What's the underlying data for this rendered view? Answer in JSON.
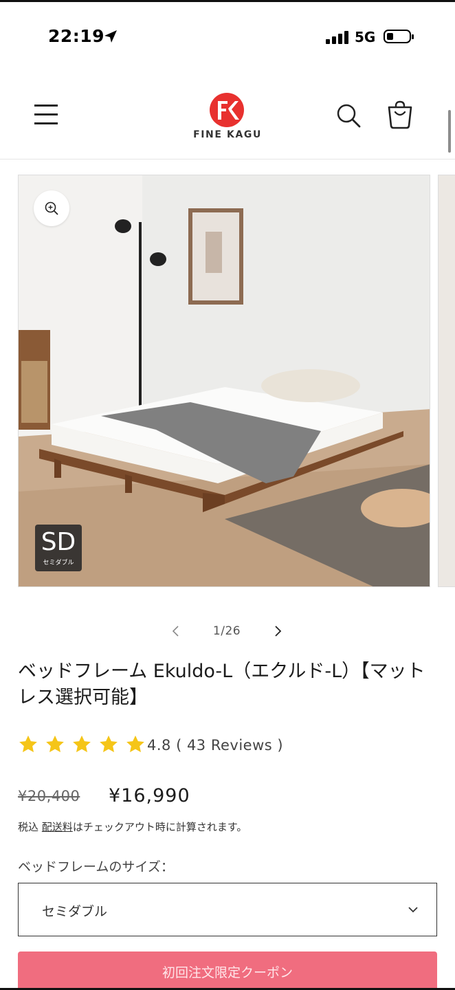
{
  "status_bar": {
    "time": "22:19",
    "network": "5G",
    "icons": [
      "location-arrow-icon",
      "signal-bars-icon",
      "battery-icon"
    ]
  },
  "header": {
    "brand": "FINE KAGU",
    "logo_mark": "FK",
    "icons": [
      "hamburger-menu-icon",
      "search-icon",
      "cart-icon",
      "fk-logo-icon"
    ],
    "colors": {
      "logo_red": "#e8312f"
    }
  },
  "gallery": {
    "size_badge_code": "SD",
    "size_badge_label": "セミダブル",
    "current": "1/26",
    "icons": [
      "zoom-in-icon",
      "chevron-left-icon",
      "chevron-right-icon"
    ]
  },
  "product": {
    "title": "ベッドフレーム Ekuldo-L（エクルド-L）【マットレス選択可能】",
    "rating": {
      "stars": 5,
      "text": "4.8 ( 43  Reviews )",
      "star_color": "#f5c518"
    },
    "price_original": "¥20,400",
    "price_sale": "¥16,990",
    "tax_prefix": "税込",
    "shipping_link": "配送料",
    "tax_suffix": "はチェックアウト時に計算されます。",
    "size_label": "ベッドフレームのサイズ：",
    "size_selected": "セミダブル",
    "coupon_button": "初回注文限定クーポン",
    "colors": {
      "coupon_bg": "#f06d7f"
    }
  }
}
